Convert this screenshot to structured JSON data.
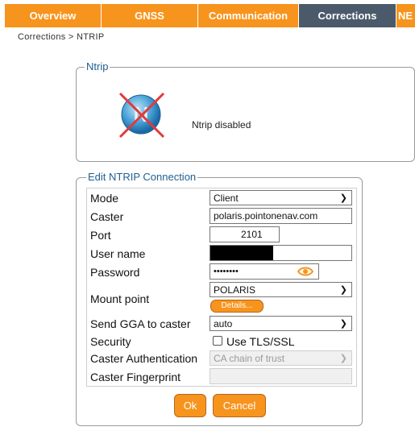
{
  "nav": {
    "tabs": [
      {
        "label": "Overview"
      },
      {
        "label": "GNSS"
      },
      {
        "label": "Communication"
      },
      {
        "label": "Corrections"
      },
      {
        "label": "NE"
      }
    ]
  },
  "breadcrumb": "Corrections > NTRIP",
  "ntrip": {
    "legend": "Ntrip",
    "status": "Ntrip disabled",
    "icon": "ntrip-disabled-icon"
  },
  "edit": {
    "legend": "Edit NTRIP Connection",
    "rows": {
      "mode": {
        "label": "Mode",
        "value": "Client"
      },
      "caster": {
        "label": "Caster",
        "value": "polaris.pointonenav.com"
      },
      "port": {
        "label": "Port",
        "value": "2101"
      },
      "username": {
        "label": "User name",
        "value": ""
      },
      "password": {
        "label": "Password",
        "value": "••••••••"
      },
      "mountpoint": {
        "label": "Mount point",
        "value": "POLARIS",
        "details": "Details..."
      },
      "gga": {
        "label": "Send GGA to caster",
        "value": "auto"
      },
      "security": {
        "label": "Security",
        "checkbox_label": "Use TLS/SSL",
        "checked": false
      },
      "auth": {
        "label": "Caster Authentication",
        "value": "CA chain of trust"
      },
      "fingerprint": {
        "label": "Caster Fingerprint",
        "value": ""
      }
    },
    "ok": "Ok",
    "cancel": "Cancel"
  },
  "colors": {
    "accent": "#f7941d",
    "tab_active": "#4a5a6a",
    "legend": "#1f5f8f"
  }
}
